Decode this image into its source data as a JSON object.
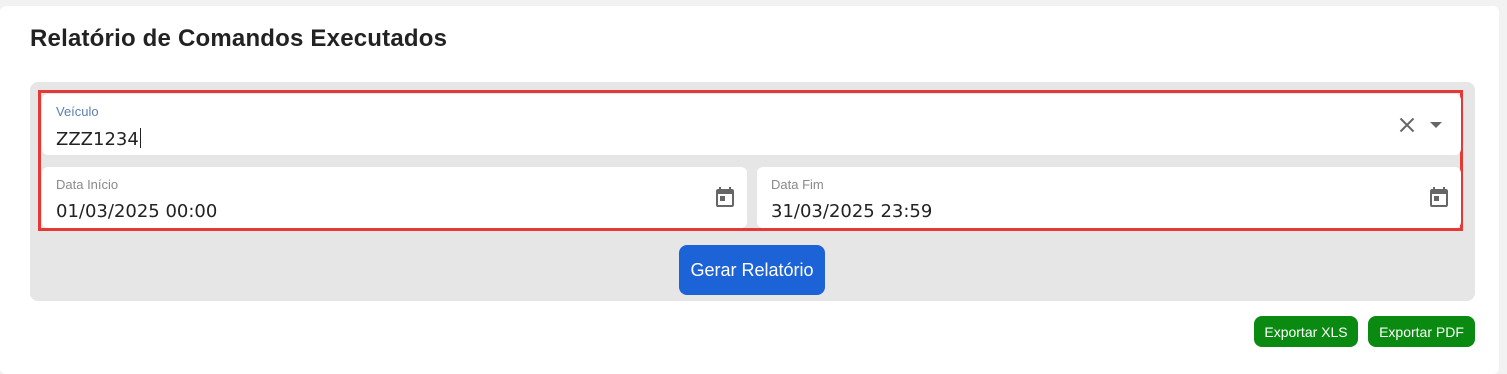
{
  "page": {
    "title": "Relatório de Comandos Executados"
  },
  "filters": {
    "veiculo": {
      "label": "Veículo",
      "value": "ZZZ1234"
    },
    "data_inicio": {
      "label": "Data Início",
      "value": "01/03/2025 00:00"
    },
    "data_fim": {
      "label": "Data Fim",
      "value": "31/03/2025 23:59"
    },
    "generate_label": "Gerar Relatório"
  },
  "exports": {
    "xls_label": "Exportar XLS",
    "pdf_label": "Exportar PDF"
  },
  "icons": {
    "clear": "close-icon",
    "dropdown": "arrow-drop-down-icon",
    "calendar": "calendar-icon"
  },
  "colors": {
    "primary_button": "#1d63d8",
    "export_button": "#0a8a10",
    "highlight_border": "#e53935",
    "panel_background": "#e6e6e6",
    "active_label": "#5b7fb0"
  }
}
